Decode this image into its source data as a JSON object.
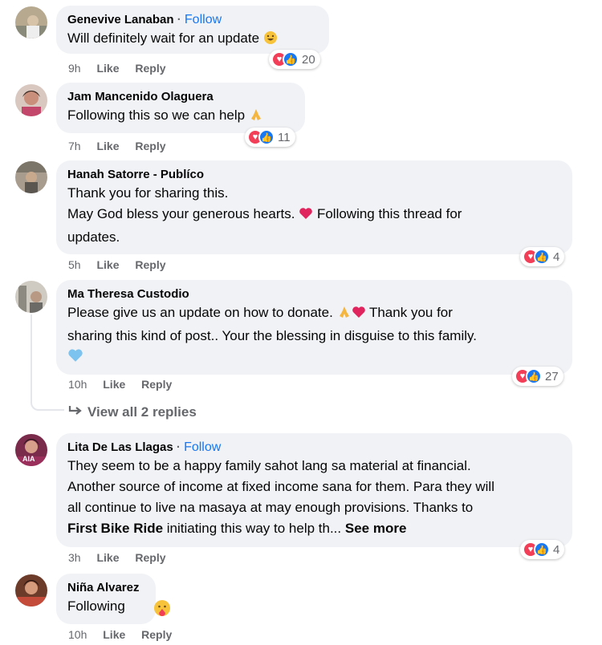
{
  "comments": [
    {
      "author": "Genevive Lanaban",
      "follow": "Follow",
      "lines": [
        "Will definitely wait for an update"
      ],
      "time": "9h",
      "like": "Like",
      "reply": "Reply",
      "reaction_count": "20"
    },
    {
      "author": "Jam Mancenido Olaguera",
      "lines": [
        "Following this so we can help"
      ],
      "time": "7h",
      "like": "Like",
      "reply": "Reply",
      "reaction_count": "11"
    },
    {
      "author": "Hanah Satorre - Publíco",
      "lines": [
        "Thank you for sharing this.",
        "May God bless your generous hearts.",
        "Following this thread for",
        "updates."
      ],
      "time": "5h",
      "like": "Like",
      "reply": "Reply",
      "reaction_count": "4"
    },
    {
      "author": "Ma Theresa Custodio",
      "lines": [
        "Please give us an update on how to donate.",
        "Thank you for",
        "sharing this kind of post.. Your the blessing in disguise to this family."
      ],
      "time": "10h",
      "like": "Like",
      "reply": "Reply",
      "reaction_count": "27",
      "view_replies": "View all 2 replies"
    },
    {
      "author": "Lita De Las Llagas",
      "follow": "Follow",
      "lines": [
        "They seem to be a happy family sahot lang sa material at financial.",
        "Another source of income at fixed income sana for them. Para they will",
        "all continue to live na masaya at may enough provisions. Thanks to",
        "First Bike Ride",
        "initiating this way to help th...",
        "See more"
      ],
      "time": "3h",
      "like": "Like",
      "reply": "Reply",
      "reaction_count": "4",
      "avatar_badge": "AIA"
    },
    {
      "author": "Niña Alvarez",
      "lines": [
        "Following"
      ],
      "time": "10h",
      "like": "Like",
      "reply": "Reply"
    }
  ],
  "icons": {
    "heart": "heart-icon",
    "like": "thumbs-up-icon",
    "reply_arrow": "reply-arrow-icon"
  },
  "colors": {
    "bubble": "#f0f2f5",
    "link": "#1877f2",
    "meta": "#65676b",
    "love": "#f33e58",
    "like": "#1877f2"
  }
}
